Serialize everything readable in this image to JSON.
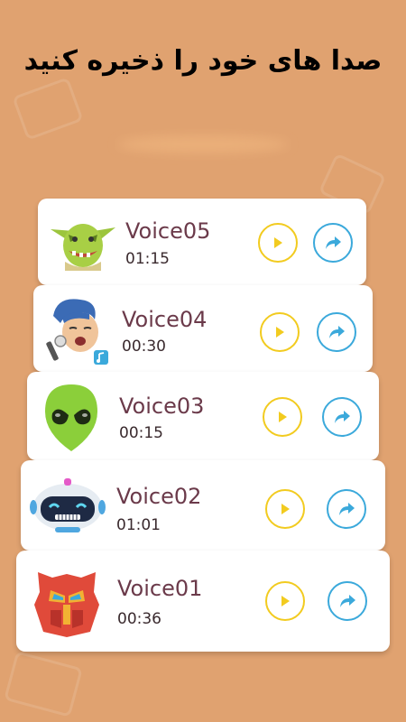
{
  "header": {
    "title": "صدا های خود را ذخیره کنید"
  },
  "voices": [
    {
      "name": "Voice05",
      "duration": "01:15",
      "avatar": "goblin-avatar-icon"
    },
    {
      "name": "Voice04",
      "duration": "00:30",
      "avatar": "singer-avatar-icon"
    },
    {
      "name": "Voice03",
      "duration": "00:15",
      "avatar": "alien-avatar-icon"
    },
    {
      "name": "Voice02",
      "duration": "01:01",
      "avatar": "robot-avatar-icon"
    },
    {
      "name": "Voice01",
      "duration": "00:36",
      "avatar": "transformer-avatar-icon"
    }
  ],
  "icons": {
    "play": "play-icon",
    "share": "share-icon"
  },
  "colors": {
    "background": "#E0A270",
    "play_accent": "#F2CB1F",
    "share_accent": "#3BA9DB",
    "name_text": "#6B3A4A"
  }
}
